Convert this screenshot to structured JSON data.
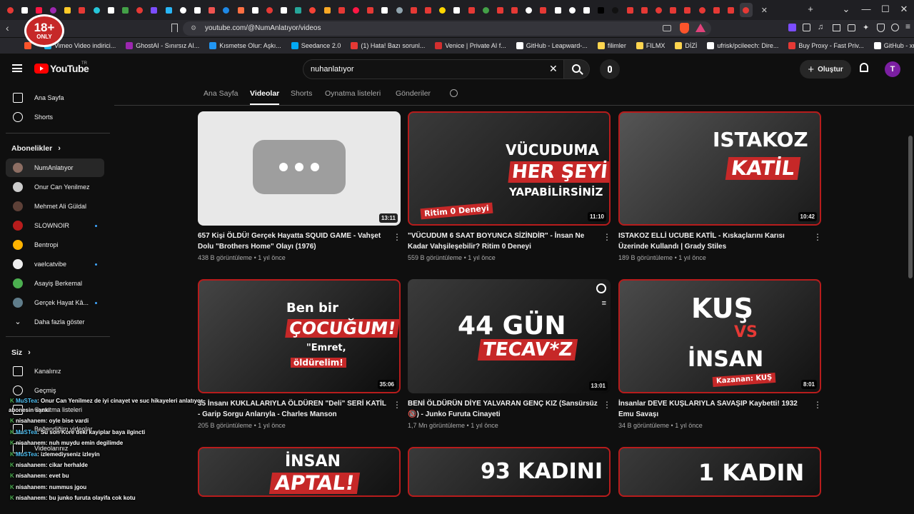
{
  "browser": {
    "url": "youtube.com/@NumAnlatıyor/videos",
    "window_controls": {
      "minimize": "—",
      "maximize": "☐",
      "close": "✕",
      "new_tab": "+",
      "tab_menu": "⌄"
    },
    "bookmarks": [
      {
        "label": "Vimeo Video indirici...",
        "color": "#1ab7ea"
      },
      {
        "label": "GhostAI - Sınırsız AI...",
        "color": "#9c27b0"
      },
      {
        "label": "Kısmetse Olur: Aşkı...",
        "color": "#2196f3"
      },
      {
        "label": "Seedance 2.0",
        "color": "#03a9f4"
      },
      {
        "label": "(1) Hata! Bazı sorunl...",
        "color": "#e53935"
      },
      {
        "label": "Venice | Private AI f...",
        "color": "#d32f2f"
      },
      {
        "label": "GitHub - Leapward-...",
        "color": "#ffffff"
      },
      {
        "label": "filimler",
        "color": "#ffd54f"
      },
      {
        "label": "FILMX",
        "color": "#ffd54f"
      },
      {
        "label": "DİZİ",
        "color": "#ffd54f"
      },
      {
        "label": "ufrisk/pcileech: Dire...",
        "color": "#ffffff"
      },
      {
        "label": "Buy Proxy - Fast Priv...",
        "color": "#e53935"
      },
      {
        "label": "GitHub - xmkg/ko-t...",
        "color": "#ffffff"
      }
    ]
  },
  "overlay_badge": {
    "number": "18+",
    "text": "ONLY"
  },
  "youtube": {
    "logo": "YouTube",
    "country": "TR",
    "search_value": "nuhanlatıyor",
    "create_label": "Oluştur",
    "avatar_letter": "T"
  },
  "sidebar": {
    "main": [
      {
        "label": "Ana Sayfa",
        "icon": "home-icon"
      },
      {
        "label": "Shorts",
        "icon": "shorts-icon"
      }
    ],
    "subs_title": "Abonelikler",
    "subs": [
      {
        "label": "NumAnlatıyor",
        "color": "#8d6e63",
        "dot": false,
        "selected": true
      },
      {
        "label": "Onur Can Yenilmez",
        "color": "#ccc",
        "dot": false
      },
      {
        "label": "Mehmet Ali Güldal",
        "color": "#5d4037",
        "dot": false
      },
      {
        "label": "SLOWNOIR",
        "color": "#b71c1c",
        "dot": true
      },
      {
        "label": "Bentropi",
        "color": "#ffb300",
        "dot": false
      },
      {
        "label": "vaelcatvibe",
        "color": "#eee",
        "dot": true
      },
      {
        "label": "Asayiş Berkemal",
        "color": "#4caf50",
        "dot": false
      },
      {
        "label": "Gerçek Hayat Kâ...",
        "color": "#607d8b",
        "dot": true
      }
    ],
    "show_more": "Daha fazla göster",
    "you_title": "Siz",
    "you_items": [
      {
        "label": "Kanalınız",
        "icon": "channel-icon"
      },
      {
        "label": "Geçmiş",
        "icon": "history-icon"
      },
      {
        "label": "Oynatma listeleri",
        "icon": "playlist-icon"
      },
      {
        "label": "Beğendiğim videolar",
        "icon": "like-icon"
      },
      {
        "label": "Videolarınız",
        "icon": "your-videos-icon"
      }
    ]
  },
  "channel_tabs": [
    "Ana Sayfa",
    "Videolar",
    "Shorts",
    "Oynatma listeleri",
    "Gönderiler"
  ],
  "active_tab": "Videolar",
  "videos": [
    {
      "title": "657 Kişi ÖLDÜ! Gerçek Hayatta SQUID GAME - Vahşet Dolu \"Brothers Home\" Olayı (1976)",
      "views": "438 B görüntüleme",
      "age": "1 yıl önce",
      "duration": "13:11"
    },
    {
      "title": "\"VÜCUDUM 6 SAAT BOYUNCA SİZİNDİR\" - İnsan Ne Kadar Vahşileşebilir? Ritim 0 Deneyi",
      "views": "559 B görüntüleme",
      "age": "1 yıl önce",
      "duration": "11:10"
    },
    {
      "title": "ISTAKOZ ELLİ UCUBE KATİL - Kıskaçlarını Karısı Üzerinde Kullandı | Grady Stiles",
      "views": "189 B görüntüleme",
      "age": "1 yıl önce",
      "duration": "10:42"
    },
    {
      "title": "35 İnsanı KUKLALARIYLA ÖLDÜREN \"Deli\" SERİ KATİL - Garip Sorgu Anlarıyla - Charles Manson",
      "views": "205 B görüntüleme",
      "age": "1 yıl önce",
      "duration": "35:06"
    },
    {
      "title": "BENİ ÖLDÜRÜN DİYE YALVARAN GENÇ KIZ (Sansürsüz 🔞) - Junko Furuta Cinayeti",
      "views": "1,7 Mn görüntüleme",
      "age": "1 yıl önce",
      "duration": "13:01"
    },
    {
      "title": "İnsanlar DEVE KUŞLARIYLA SAVAŞIP Kaybetti! 1932 Emu Savaşı",
      "views": "34 B görüntüleme",
      "age": "1 yıl önce",
      "duration": "8:01"
    }
  ],
  "thumb_text": {
    "t2": [
      "VÜCUDUMA",
      "HER ŞEYİ",
      "YAPABİLİRSİNİZ",
      "Ritim 0 Deneyi"
    ],
    "t3": [
      "ISTAKOZ",
      "KATİL"
    ],
    "t4": [
      "Ben bir",
      "ÇOCUĞUM!",
      "\"Emret,",
      "öldürelim!"
    ],
    "t5": [
      "44 GÜN",
      "TECAV*Z"
    ],
    "t6": [
      "KUŞ",
      "VS",
      "İNSAN",
      "Kazanan: KUŞ"
    ],
    "t7": [
      "İNSAN",
      "APTAL!"
    ],
    "t8": [
      "93 KADINI"
    ],
    "t9": [
      "1 KADIN"
    ]
  },
  "chat": [
    {
      "user": "MuSTea",
      "msg": ": Onur Can Yenilmez de iyi cinayet ve suc hikayeleri anlatıyor",
      "color": "u1"
    },
    {
      "user": "",
      "msg": "abonesin sanki",
      "color": "u2"
    },
    {
      "user": "nisahanem",
      "msg": ": oyle bise vardi",
      "color": "u2"
    },
    {
      "user": "MuSTea",
      "msg": ": Su son Kore deki kayiplar baya ilgincti",
      "color": "u1"
    },
    {
      "user": "nisahanem",
      "msg": ": nuh muydu emin degilimde",
      "color": "u2"
    },
    {
      "user": "MuSTea",
      "msg": ": izlemediyseniz izleyin",
      "color": "u1"
    },
    {
      "user": "nisahanem",
      "msg": ": cikar herhalde",
      "color": "u2"
    },
    {
      "user": "nisahanem",
      "msg": ": evet bu",
      "color": "u2"
    },
    {
      "user": "nisahanem",
      "msg": ": nummus jgou",
      "color": "u2"
    },
    {
      "user": "nisahanem",
      "msg": ": bu junko furuta olayifa cok kotu",
      "color": "u2"
    }
  ]
}
